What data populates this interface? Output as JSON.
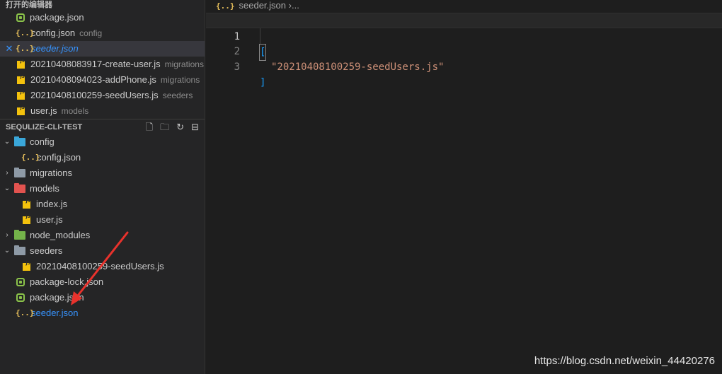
{
  "open_editors": {
    "title": "打开的编辑器",
    "items": [
      {
        "name": "package.json",
        "desc": "",
        "icon": "npm-package-icon"
      },
      {
        "name": "config.json",
        "desc": "config",
        "icon": "json-icon"
      },
      {
        "name": "seeder.json",
        "desc": "",
        "icon": "json-icon",
        "close": "✕"
      },
      {
        "name": "20210408083917-create-user.js",
        "desc": "migrations",
        "icon": "js-icon"
      },
      {
        "name": "20210408094023-addPhone.js",
        "desc": "migrations",
        "icon": "js-icon"
      },
      {
        "name": "20210408100259-seedUsers.js",
        "desc": "seeders",
        "icon": "js-icon"
      },
      {
        "name": "user.js",
        "desc": "models",
        "icon": "js-icon"
      }
    ]
  },
  "explorer": {
    "title": "SEQULIZE-CLI-TEST",
    "actions": [
      "new-file-icon",
      "new-folder-icon",
      "refresh-icon",
      "collapse-all-icon"
    ],
    "tree": [
      {
        "name": "config",
        "type": "folder",
        "expanded": true
      },
      {
        "name": "config.json",
        "type": "json"
      },
      {
        "name": "migrations",
        "type": "folder",
        "expanded": false
      },
      {
        "name": "models",
        "type": "folder",
        "expanded": true
      },
      {
        "name": "index.js",
        "type": "js"
      },
      {
        "name": "user.js",
        "type": "js"
      },
      {
        "name": "node_modules",
        "type": "folder",
        "expanded": false
      },
      {
        "name": "seeders",
        "type": "folder",
        "expanded": true
      },
      {
        "name": "20210408100259-seedUsers.js",
        "type": "js"
      },
      {
        "name": "package-lock.json",
        "type": "npm"
      },
      {
        "name": "package.json",
        "type": "npm"
      },
      {
        "name": "seeder.json",
        "type": "json"
      }
    ]
  },
  "editor": {
    "breadcrumb": {
      "file": "seeder.json",
      "sep": "›",
      "more": "..."
    },
    "lines": [
      {
        "num": "1",
        "text": "["
      },
      {
        "num": "2",
        "text": "\"20210408100259-seedUsers.js\""
      },
      {
        "num": "3",
        "text": "]"
      }
    ]
  },
  "watermark": "https://blog.csdn.net/weixin_44420276",
  "colors": {
    "accent": "#3794ff",
    "arrow": "#e8322c",
    "string": "#ce9178",
    "bracket": "#179fff"
  }
}
